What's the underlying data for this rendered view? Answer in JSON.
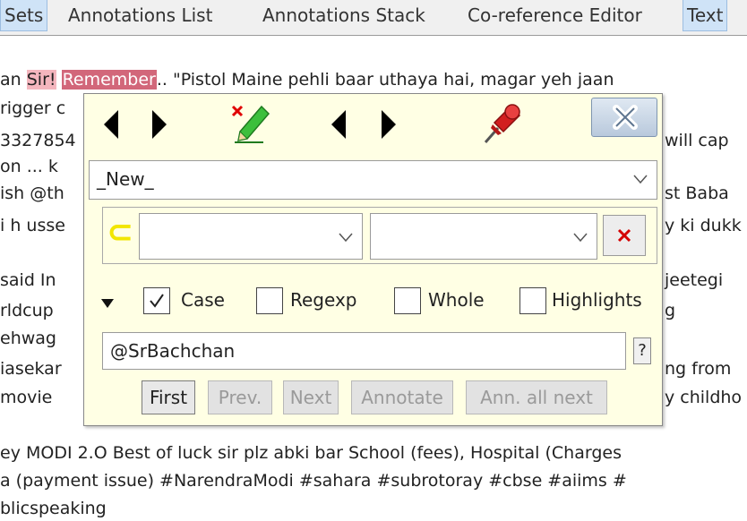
{
  "tabs": [
    {
      "label": "Sets",
      "selected": true
    },
    {
      "label": "Annotations List",
      "selected": false
    },
    {
      "label": "Annotations Stack",
      "selected": false
    },
    {
      "label": "Co-reference Editor",
      "selected": false
    },
    {
      "label": "Text",
      "selected": true
    }
  ],
  "document": {
    "line1": {
      "prefix": "an ",
      "sir": "Sir!",
      "gap": " ",
      "remember": "Remember",
      "rest": ".. \"Pistol Maine pehli baar uthaya hai, magar yeh jaan"
    },
    "left_fragments": [
      "rigger c",
      "3327854",
      "on ... k",
      "ish @th",
      "i h usse",
      "",
      "said In",
      "rldcup",
      "ehwag",
      "iasekar",
      "movie"
    ],
    "right_fragments": [
      "will cap",
      "st Baba",
      "y ki dukk",
      "jeetegi",
      "g",
      "ng from",
      "y childho"
    ],
    "bottom_lines": [
      "ey MODI 2.O Best of luck sir plz abki bar School (fees), Hospital (Charges",
      "a (payment issue) #NarendraModi #sahara #subrotoray #cbse #aiims #",
      "blicspeaking"
    ]
  },
  "dialog": {
    "annotation_type": "_New_",
    "rule_symbol": "⊂",
    "rule_left_value": "",
    "rule_right_value": "",
    "options": {
      "case": {
        "label": "Case",
        "checked": true
      },
      "regexp": {
        "label": "Regexp",
        "checked": false
      },
      "whole": {
        "label": "Whole",
        "checked": false
      },
      "highlights": {
        "label": "Highlights",
        "checked": false
      }
    },
    "search_value": "@SrBachchan",
    "help_label": "?",
    "buttons": {
      "first": "First",
      "prev": "Prev.",
      "next": "Next",
      "annotate": "Annotate",
      "annotate_all_next": "Ann. all next"
    },
    "colors": {
      "background": "#ffffe4",
      "rule_symbol": "#f2e600",
      "delete_x": "#d40000",
      "highlight_remember": "#d2677a",
      "highlight_sir": "#f4b6be"
    },
    "icons": {
      "nav_left": "left-triangle-icon",
      "nav_right": "right-triangle-icon",
      "edit": "green-pencil-with-red-x-icon",
      "pin": "red-pushpin-icon",
      "close": "close-x-icon"
    }
  }
}
